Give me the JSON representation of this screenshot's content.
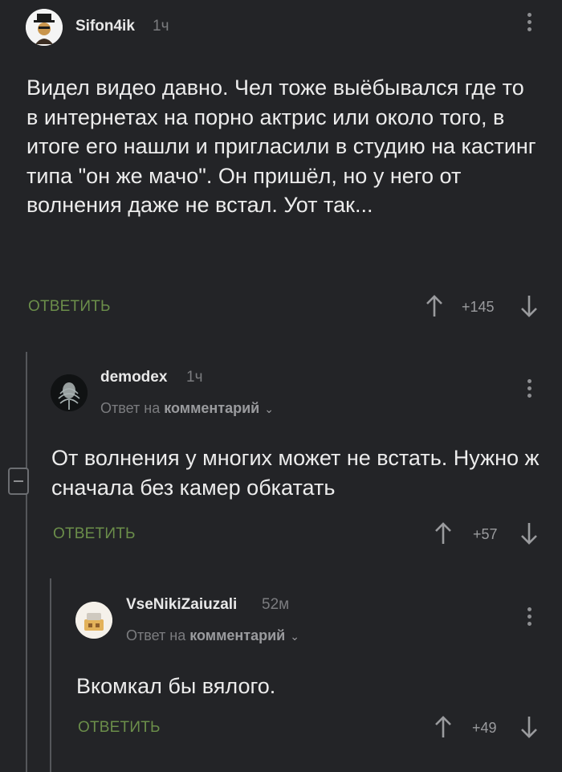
{
  "comments": [
    {
      "username": "Sifon4ik",
      "time": "1ч",
      "text": "Видел видео давно. Чел тоже выёбывался где то в интернетах на порно актрис или около того, в итоге его нашли и пригласили в студию на кастинг типа \"он же мачо\". Он пришёл, но у него от волнения даже не встал. Уот так...",
      "reply_label": "ОТВЕТИТЬ",
      "score": "+145"
    },
    {
      "username": "demodex",
      "time": "1ч",
      "reply_prefix": "Ответ на",
      "reply_target": "комментарий",
      "text": "От волнения у многих может не встать. Нужно ж сначала без камер обкатать",
      "reply_label": "ОТВЕТИТЬ",
      "score": "+57"
    },
    {
      "username": "VseNikiZaiuzali",
      "time": "52м",
      "reply_prefix": "Ответ на",
      "reply_target": "комментарий",
      "text": "Вкомкал бы вялого.",
      "reply_label": "ОТВЕТИТЬ",
      "score": "+49"
    }
  ],
  "colors": {
    "background": "#232427",
    "reply_green": "#6b8e4a",
    "muted": "#7b7c7f"
  },
  "icons": [
    "kebab-menu-icon",
    "arrow-up-icon",
    "arrow-down-icon",
    "chevron-down-icon",
    "collapse-icon"
  ]
}
